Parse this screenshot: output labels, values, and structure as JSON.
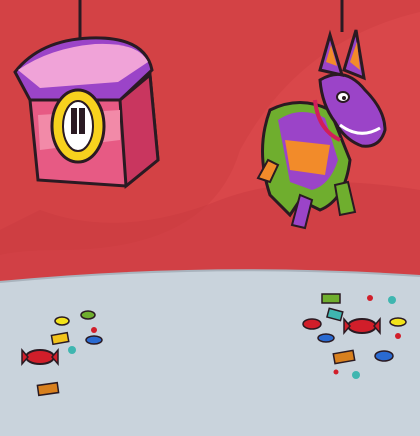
{
  "scene": {
    "objects": [
      "puffle-pinata",
      "donkey-pinata",
      "scattered-candy"
    ]
  },
  "colors": {
    "wall": "#d9474a",
    "wall_shadow": "#c63a3e",
    "floor": "#c9d3dc",
    "floor_edge": "#b8c4cf",
    "outline": "#2a1a22"
  }
}
